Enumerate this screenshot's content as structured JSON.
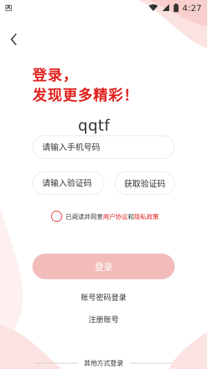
{
  "status_bar": {
    "badge": "A",
    "time": "4:27"
  },
  "headline": {
    "line1": "登录，",
    "line2": "发现更多精彩！"
  },
  "watermark": "qqtf",
  "form": {
    "phone_placeholder": "请输入手机号码",
    "code_placeholder": "请输入验证码",
    "get_code_label": "获取验证码"
  },
  "agreement": {
    "prefix": "已阅读并同意",
    "user_agreement": "用户协议",
    "and": "和",
    "privacy_policy": "隐私政策"
  },
  "actions": {
    "login_label": "登录",
    "password_login_label": "账号密码登录",
    "register_label": "注册账号"
  },
  "other_login_label": "其他方式登录",
  "colors": {
    "accent": "#e0201c",
    "login_button_disabled": "#f2bcbb",
    "decor": "#f8c8c6"
  }
}
